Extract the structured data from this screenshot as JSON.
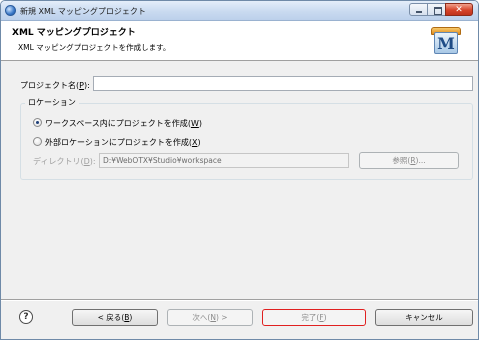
{
  "window": {
    "title": "新規 XML マッピングプロジェクト",
    "icon": "globe-icon"
  },
  "banner": {
    "title": "XML マッピングプロジェクト",
    "description": "XML マッピングプロジェクトを作成します。",
    "logo_letter": "M"
  },
  "form": {
    "project_name_label": "プロジェクト名",
    "project_name_mnemonic": "P",
    "project_name_value": "",
    "location_group_title": "ロケーション",
    "radio_workspace_label": "ワークスペース内にプロジェクトを作成",
    "radio_workspace_mnemonic": "W",
    "radio_workspace_selected": true,
    "radio_external_label": "外部ロケーションにプロジェクトを作成",
    "radio_external_mnemonic": "X",
    "radio_external_selected": false,
    "directory_label": "ディレクトリ",
    "directory_mnemonic": "D",
    "directory_value": "D:¥WebOTX¥Studio¥workspace",
    "browse_label": "参照",
    "browse_mnemonic": "R"
  },
  "buttons": {
    "back_label": "< 戻る",
    "back_mnemonic": "B",
    "next_label": "次へ",
    "next_mnemonic": "N",
    "next_suffix": " >",
    "finish_label": "完了",
    "finish_mnemonic": "F",
    "cancel_label": "キャンセル"
  },
  "help_glyph": "?"
}
